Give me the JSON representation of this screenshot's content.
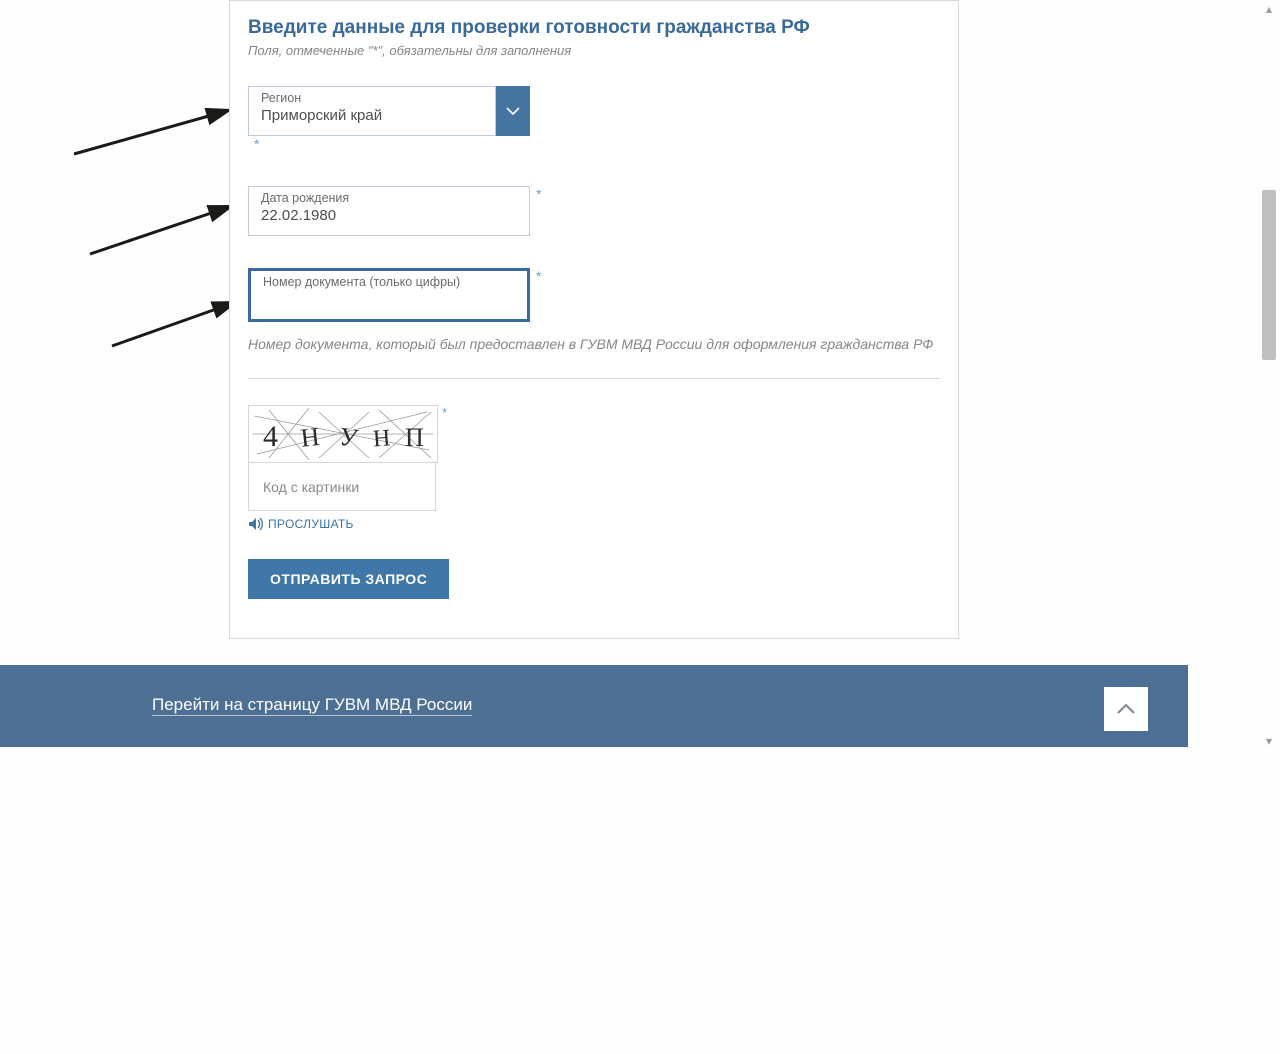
{
  "form": {
    "title": "Введите данные для проверки готовности гражданства РФ",
    "required_hint": "Поля, отмеченные \"*\", обязательны для заполнения",
    "region": {
      "label": "Регион",
      "value": "Приморский край"
    },
    "dob": {
      "label": "Дата рождения",
      "value": "22.02.1980"
    },
    "doc": {
      "label": "Номер документа (только цифры)",
      "value": ""
    },
    "doc_hint": "Номер документа, который был предоставлен в ГУВМ МВД России для оформления гражданства РФ",
    "captcha": {
      "text": "4 Н У Н П",
      "input_placeholder": "Код с картинки",
      "listen": "ПРОСЛУШАТЬ"
    },
    "submit": "ОТПРАВИТЬ ЗАПРОС"
  },
  "footer": {
    "link": "Перейти на страницу ГУВМ МВД России"
  }
}
